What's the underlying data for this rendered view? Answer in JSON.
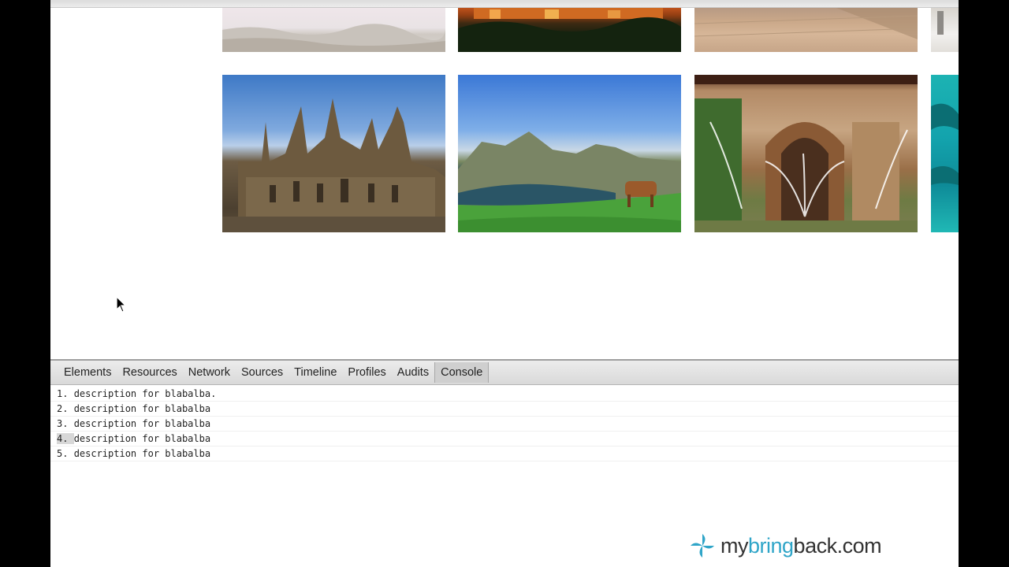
{
  "gallery": {
    "rows": [
      {
        "images": [
          "snowy-landscape",
          "sunset-fortress-over-forest",
          "plaza-steps",
          "partial-image"
        ]
      },
      {
        "images": [
          "gothic-cathedral",
          "mountain-lake-with-cow",
          "moorish-palace-fountain",
          "turquoise-water"
        ]
      }
    ]
  },
  "devtools": {
    "tabs": [
      "Elements",
      "Resources",
      "Network",
      "Sources",
      "Timeline",
      "Profiles",
      "Audits",
      "Console"
    ],
    "active_tab": "Console",
    "console_lines": [
      {
        "num": "1. ",
        "text": "description for blabalba."
      },
      {
        "num": "2. ",
        "text": "description for blabalba"
      },
      {
        "num": "3. ",
        "text": "description for blabalba"
      },
      {
        "num": "4. ",
        "text": "description for blabalba"
      },
      {
        "num": "5. ",
        "text": "description for blabalba"
      }
    ]
  },
  "watermark": {
    "prefix": "my",
    "highlight": "bring",
    "suffix": "back.com"
  },
  "colors": {
    "accent": "#2fa5c8",
    "panel_bg": "#ffffff",
    "toolbar_bg": "#dedede"
  }
}
